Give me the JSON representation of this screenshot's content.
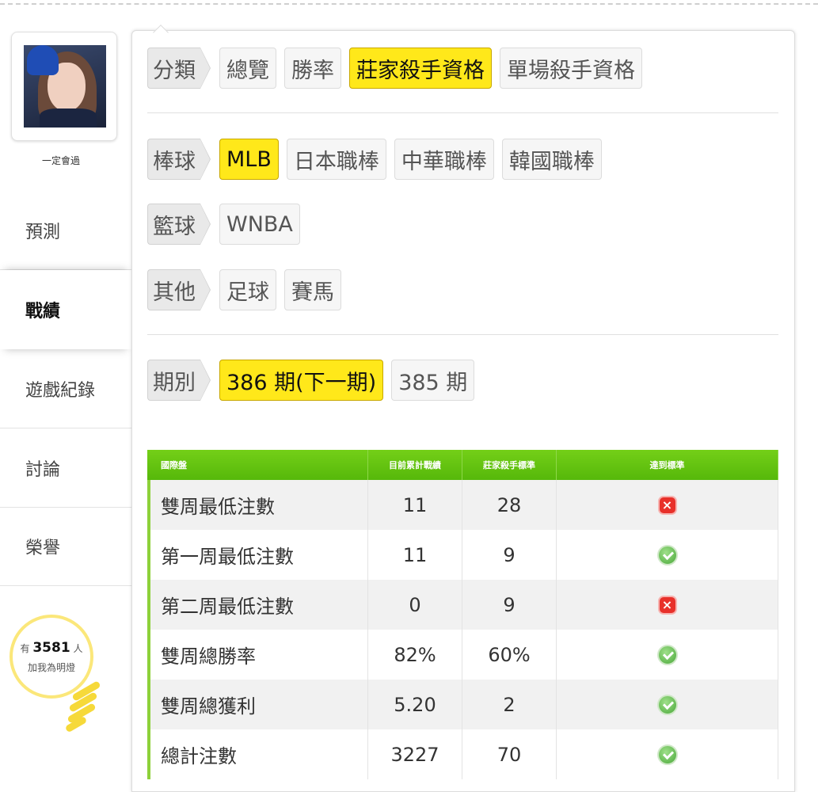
{
  "profile": {
    "username": "一定會過"
  },
  "sidebar": {
    "items": [
      {
        "label": "預測"
      },
      {
        "label": "戰績"
      },
      {
        "label": "遊戲紀錄"
      },
      {
        "label": "討論"
      },
      {
        "label": "榮譽"
      }
    ],
    "fans": {
      "prefix": "有",
      "count": "3581",
      "suffix": "人",
      "caption": "加我為明燈"
    }
  },
  "filters": {
    "category": {
      "label": "分類",
      "options": [
        "總覽",
        "勝率",
        "莊家殺手資格",
        "單場殺手資格"
      ],
      "selected": "莊家殺手資格"
    },
    "baseball": {
      "label": "棒球",
      "options": [
        "MLB",
        "日本職棒",
        "中華職棒",
        "韓國職棒"
      ],
      "selected": "MLB"
    },
    "basketball": {
      "label": "籃球",
      "options": [
        "WNBA"
      ]
    },
    "other": {
      "label": "其他",
      "options": [
        "足球",
        "賽馬"
      ]
    },
    "period": {
      "label": "期別",
      "options": [
        "386 期(下一期)",
        "385 期"
      ],
      "selected": "386 期(下一期)"
    }
  },
  "table": {
    "headers": [
      "國際盤",
      "目前累計戰績",
      "莊家殺手標準",
      "達到標準"
    ],
    "rows": [
      {
        "name": "雙周最低注數",
        "current": "11",
        "standard": "28",
        "met": false
      },
      {
        "name": "第一周最低注數",
        "current": "11",
        "standard": "9",
        "met": true
      },
      {
        "name": "第二周最低注數",
        "current": "0",
        "standard": "9",
        "met": false
      },
      {
        "name": "雙周總勝率",
        "current": "82%",
        "standard": "60%",
        "met": true
      },
      {
        "name": "雙周總獲利",
        "current": "5.20",
        "standard": "2",
        "met": true
      },
      {
        "name": "總計注數",
        "current": "3227",
        "standard": "70",
        "met": true
      }
    ]
  }
}
